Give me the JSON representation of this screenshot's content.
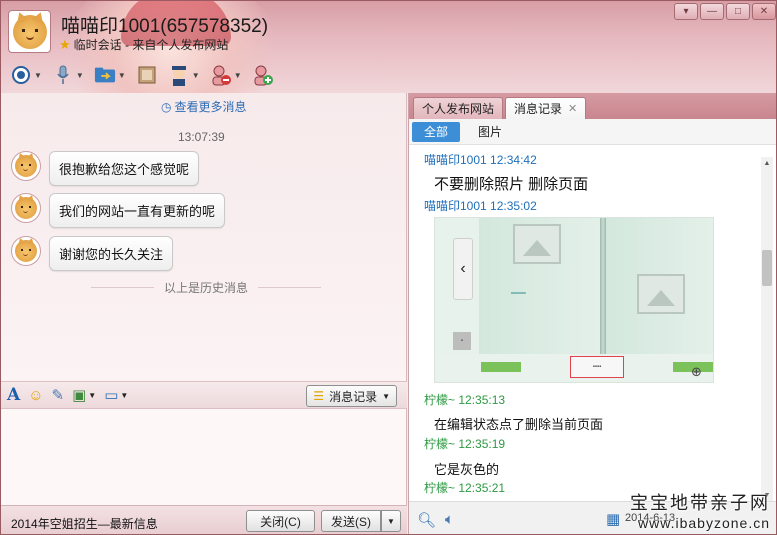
{
  "header": {
    "title": "喵喵印1001(657578352)",
    "subtitle": "临时会话 - 来自个人发布网站",
    "toolbar": [
      {
        "icon": "camera-icon"
      },
      {
        "icon": "microphone-icon"
      },
      {
        "icon": "file-transfer-icon"
      },
      {
        "icon": "screen-share-icon"
      },
      {
        "icon": "agent-icon"
      },
      {
        "icon": "block-user-icon"
      },
      {
        "icon": "add-contact-icon"
      }
    ],
    "window_controls": {
      "menu": "▾",
      "minimize": "—",
      "maximize": "□",
      "close": "✕"
    }
  },
  "chat": {
    "more_link": "查看更多消息",
    "time": "13:07:39",
    "messages": [
      {
        "text": "很抱歉给您这个感觉呢"
      },
      {
        "text": "我们的网站一直有更新的呢"
      },
      {
        "text": "谢谢您的长久关注"
      }
    ],
    "history_divider": "以上是历史消息"
  },
  "input_toolbar": {
    "history_button": "消息记录"
  },
  "bottom": {
    "ad_text": "2014年空姐招生—最新信息",
    "close_button": "关闭(C)",
    "send_button": "发送(S)"
  },
  "right_panel": {
    "tabs": [
      {
        "label": "个人发布网站",
        "active": false
      },
      {
        "label": "消息记录",
        "active": true
      }
    ],
    "filters": [
      {
        "label": "全部",
        "active": true
      },
      {
        "label": "图片",
        "active": false
      }
    ],
    "records": [
      {
        "sender": "喵喵印1001",
        "time": "12:34:42",
        "color": "#1f6fb9",
        "text": "不要删除照片 删除页面"
      },
      {
        "sender": "喵喵印1001",
        "time": "12:35:02",
        "color": "#1f6fb9",
        "image": true
      },
      {
        "sender": "柠檬~",
        "time": "12:35:13",
        "color": "#2d9a42",
        "text": "在编辑状态点了删除当前页面"
      },
      {
        "sender": "柠檬~",
        "time": "12:35:19",
        "color": "#2d9a42",
        "text": "它是灰色的"
      },
      {
        "sender": "柠檬~",
        "time": "12:35:21",
        "color": "#2d9a42",
        "text": ""
      }
    ],
    "bottom_date": "2014-6-13"
  },
  "watermark": {
    "line1": "宝宝地带亲子网",
    "line2": "www.ibabyzone.cn"
  }
}
